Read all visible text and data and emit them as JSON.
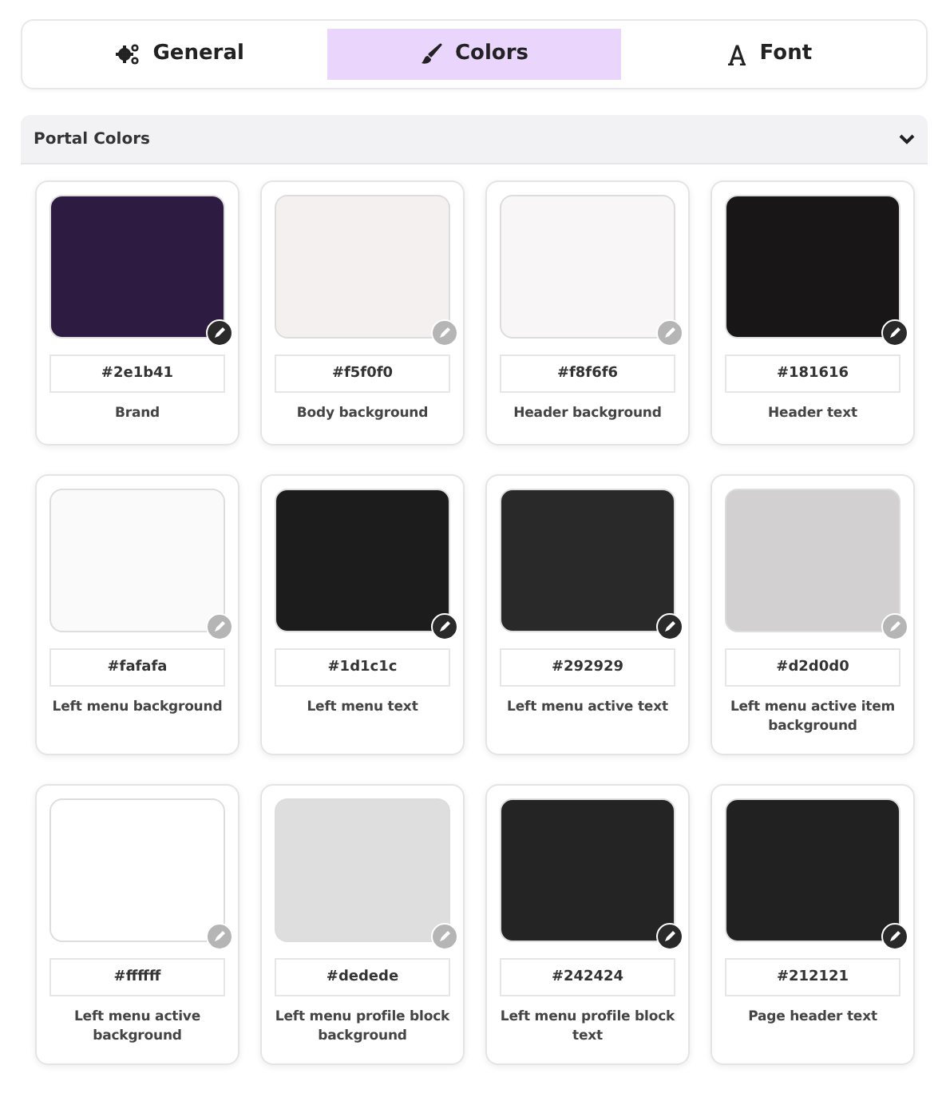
{
  "tabs": [
    {
      "label": "General",
      "selected": false
    },
    {
      "label": "Colors",
      "selected": true
    },
    {
      "label": "Font",
      "selected": false
    }
  ],
  "section": {
    "title": "Portal Colors",
    "expanded": true
  },
  "colors": [
    {
      "hex": "#2e1b41",
      "color": "#2e1b41",
      "label": "Brand"
    },
    {
      "hex": "#f5f0f0",
      "color": "#f5f0f0",
      "label": "Body background"
    },
    {
      "hex": "#f8f6f6",
      "color": "#f8f6f6",
      "label": "Header background"
    },
    {
      "hex": "#181616",
      "color": "#181616",
      "label": "Header text"
    },
    {
      "hex": "#fafafa",
      "color": "#fafafa",
      "label": "Left menu background"
    },
    {
      "hex": "#1d1c1c",
      "color": "#1d1c1c",
      "label": "Left menu text"
    },
    {
      "hex": "#292929",
      "color": "#292929",
      "label": "Left menu active text"
    },
    {
      "hex": "#d2d0d0",
      "color": "#d2d0d0",
      "label": "Left menu active item background"
    },
    {
      "hex": "#ffffff",
      "color": "#ffffff",
      "label": "Left menu active background"
    },
    {
      "hex": "#dedede",
      "color": "#dedede",
      "label": "Left menu profile block background"
    },
    {
      "hex": "#242424",
      "color": "#242424",
      "label": "Left menu profile block text"
    },
    {
      "hex": "#212121",
      "color": "#212121",
      "label": "Page header text"
    }
  ]
}
